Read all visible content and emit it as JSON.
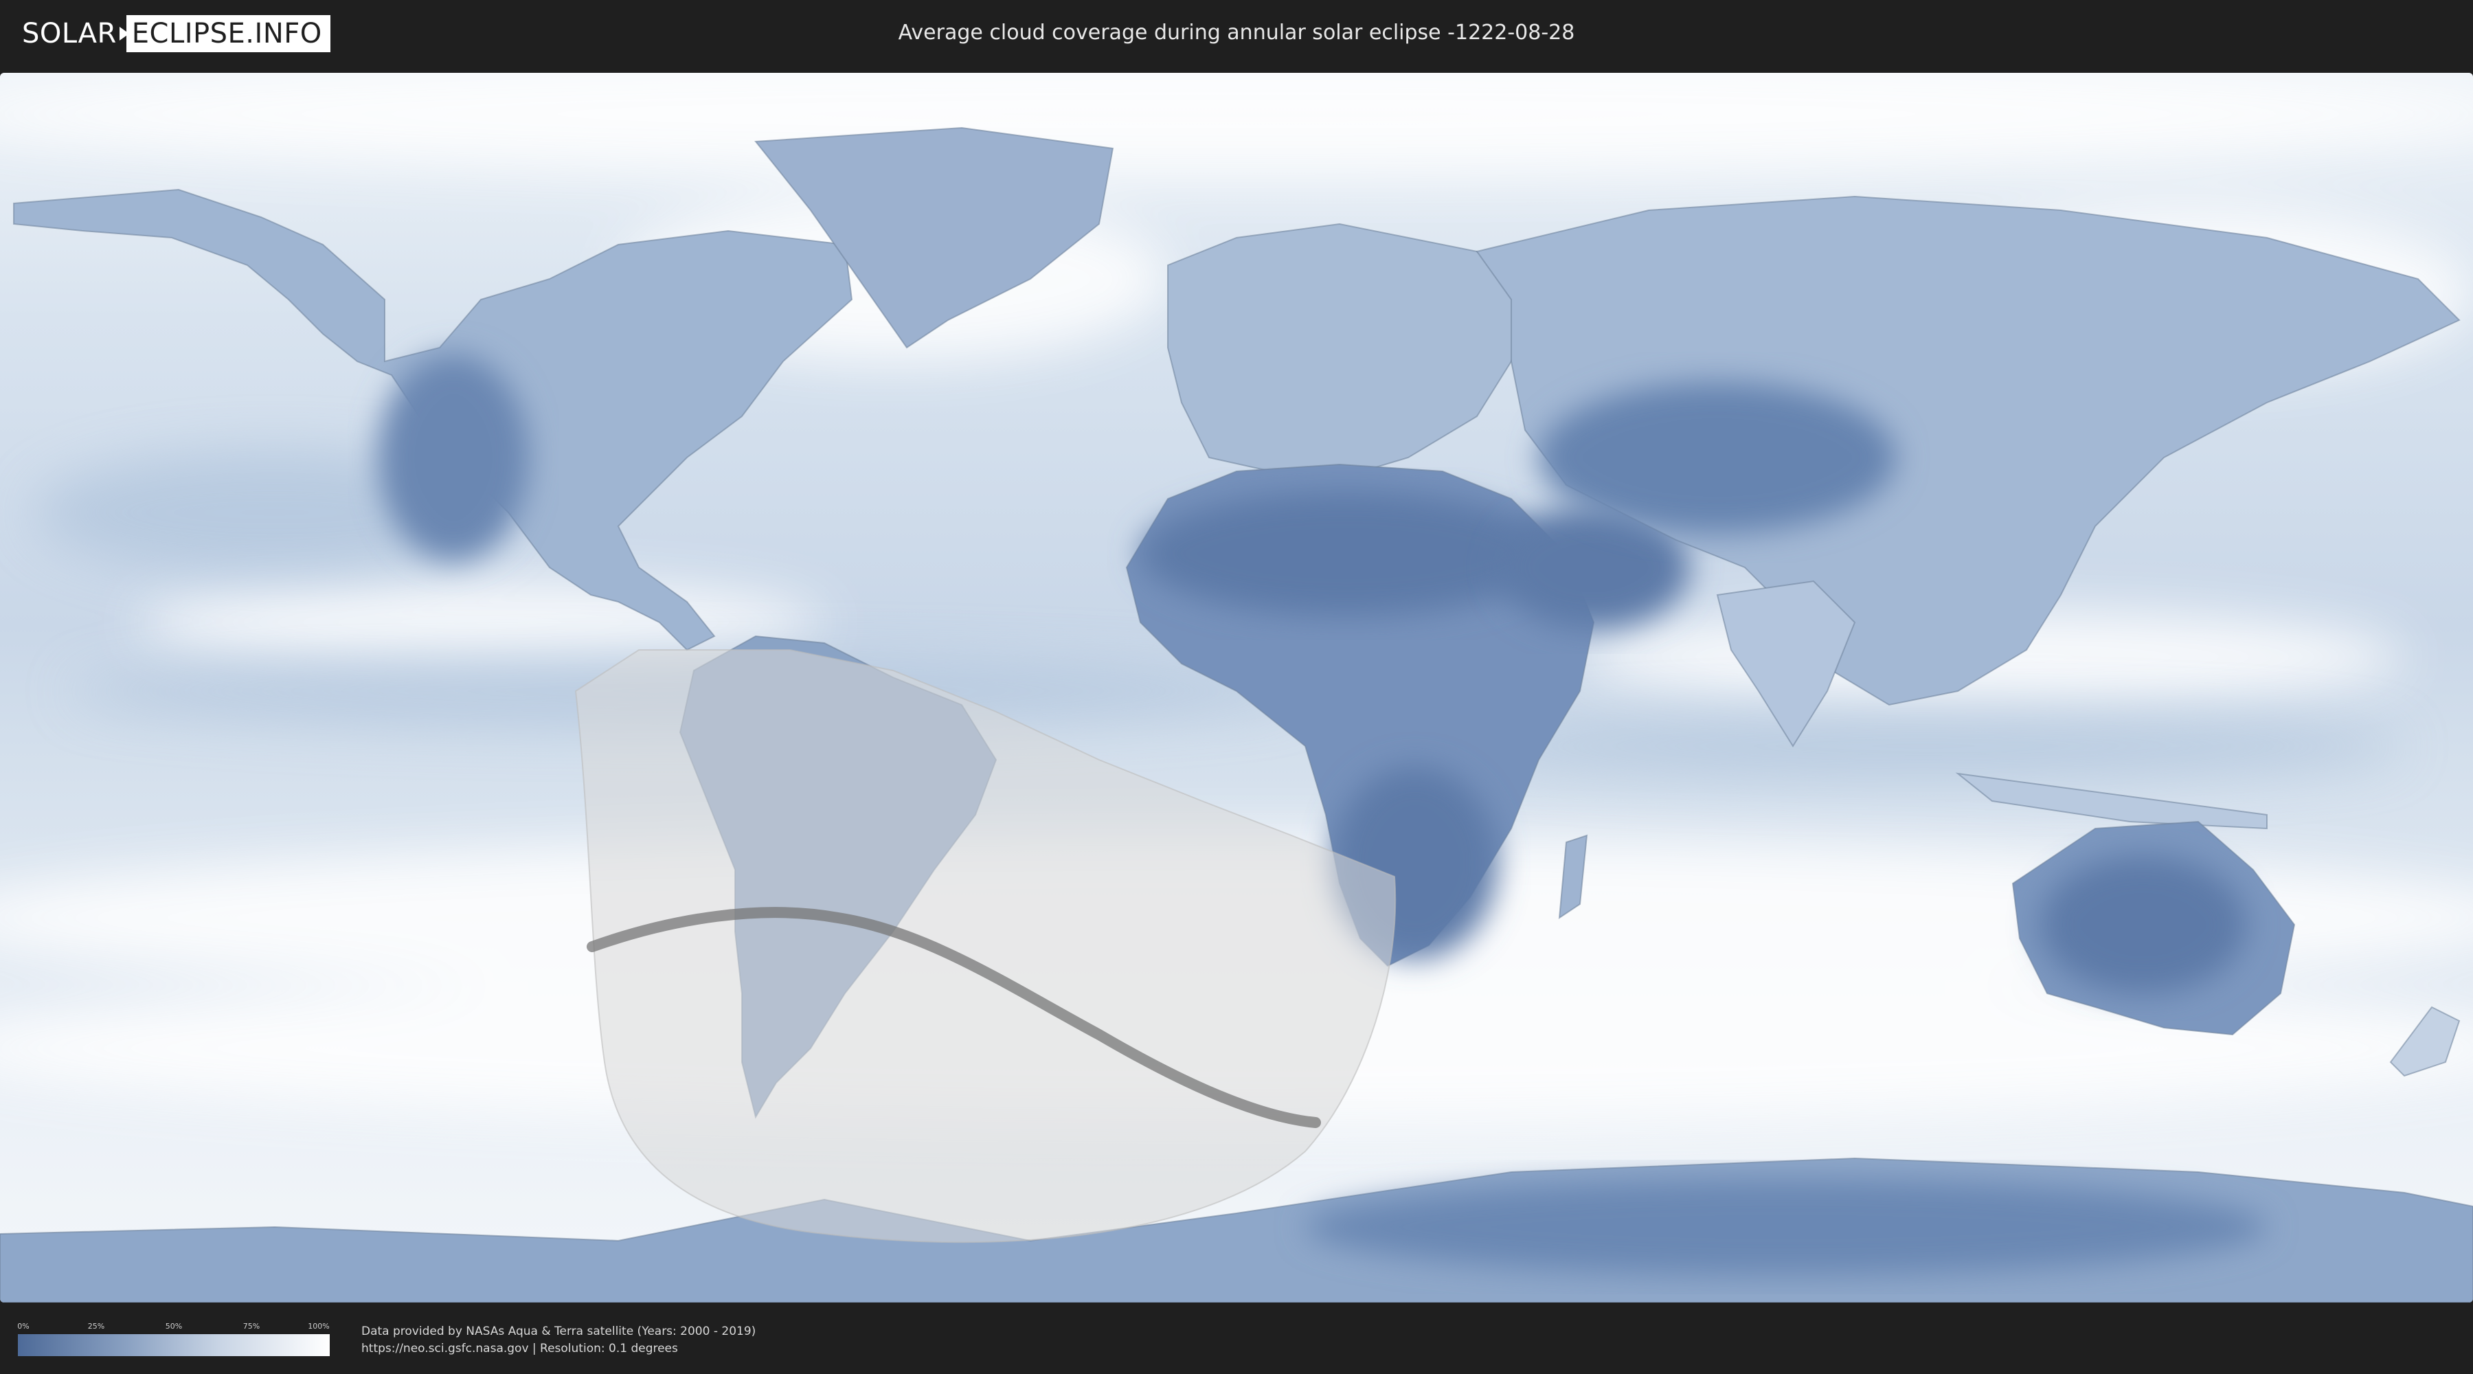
{
  "header": {
    "logo_part1": "SOLAR",
    "logo_part2": "ECLIPSE.INFO",
    "title": "Average cloud coverage during annular solar eclipse -1222-08-28"
  },
  "map": {
    "colors": {
      "ocean_base": "#dfe8f2",
      "clear_sky": "#5d7aa8",
      "cloud": "#ffffff",
      "eclipse_zone": "#d9d9d9",
      "central_path": "#777777",
      "coastline": "#6b7f99"
    }
  },
  "legend": {
    "ticks": [
      "0%",
      "25%",
      "50%",
      "75%",
      "100%"
    ],
    "gradient_start": "#4d6a98",
    "gradient_end": "#ffffff"
  },
  "credits": {
    "line1": "Data provided by NASAs Aqua & Terra satellite (Years: 2000 - 2019)",
    "line2": "https://neo.sci.gsfc.nasa.gov | Resolution: 0.1 degrees"
  }
}
